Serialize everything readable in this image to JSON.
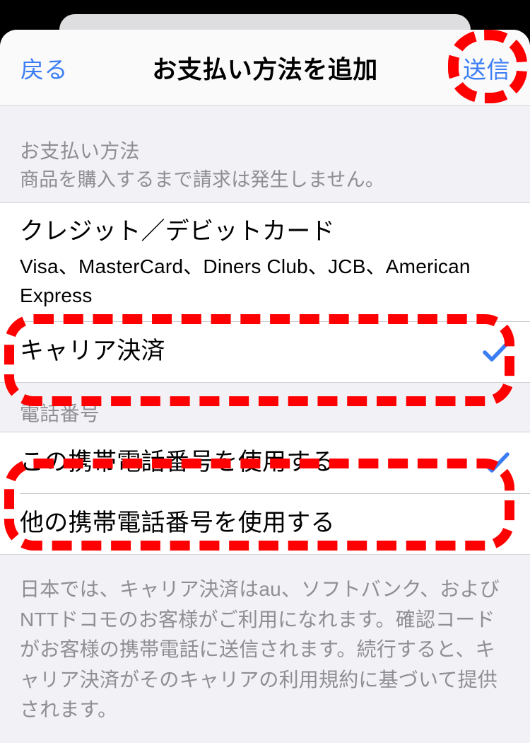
{
  "navbar": {
    "back_label": "戻る",
    "title": "お支払い方法を追加",
    "action_label": "送信"
  },
  "payment_section": {
    "header": "お支払い方法",
    "subheader": "商品を購入するまで請求は発生しません。",
    "options": [
      {
        "title": "クレジット／デビットカード",
        "subtitle": "Visa、MasterCard、Diners Club、JCB、American Express",
        "checked": false
      },
      {
        "title": "キャリア決済",
        "subtitle": "",
        "checked": true
      }
    ]
  },
  "phone_section": {
    "header": "電話番号",
    "options": [
      {
        "title": "この携帯電話番号を使用する",
        "checked": true
      },
      {
        "title": "他の携帯電話番号を使用する",
        "checked": false
      }
    ]
  },
  "footer": {
    "note": "日本では、キャリア決済はau、ソフトバンク、およびNTTドコモのお客様がご利用になれます。確認コードがお客様の携帯電話に送信されます。続行すると、キャリア決済がそのキャリアの利用規約に基づいて提供されます。"
  },
  "colors": {
    "accent_blue": "#3b7df4",
    "annotation_red": "#ff0000",
    "group_background": "#f2f2f6",
    "row_background": "#ffffff",
    "secondary_text": "#8e8e93"
  }
}
